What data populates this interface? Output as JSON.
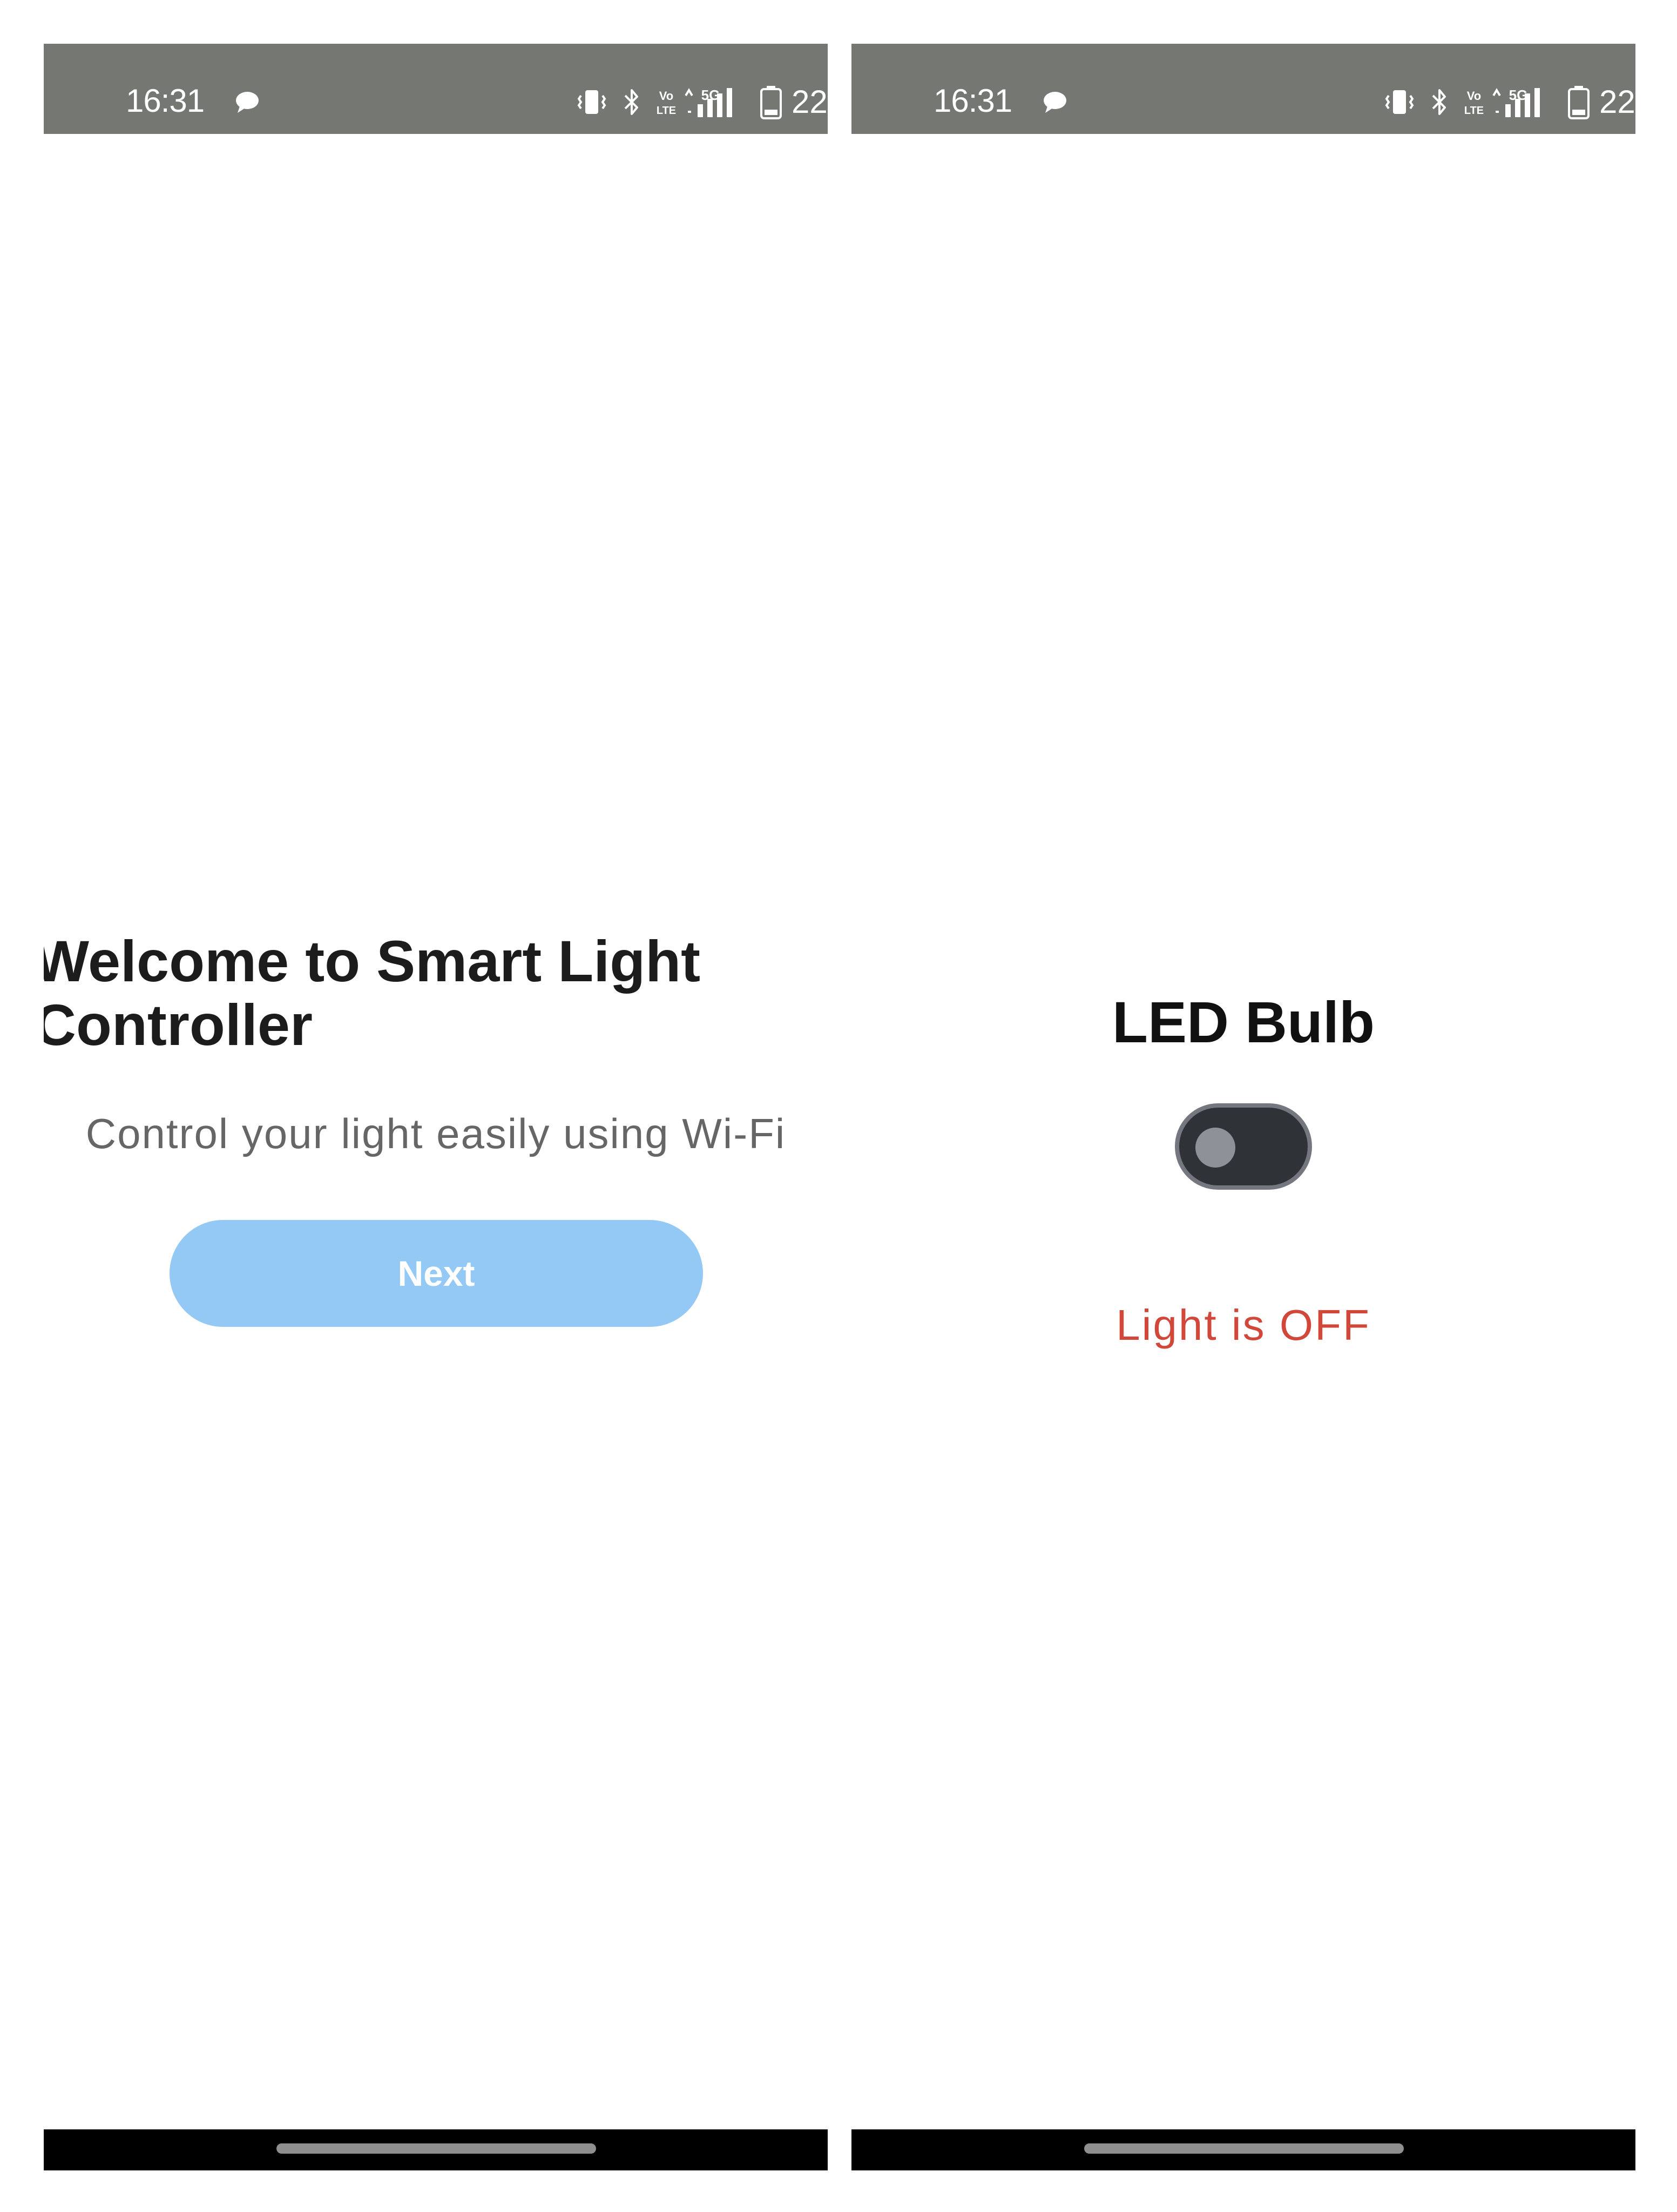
{
  "status_bar": {
    "time": "16:31",
    "battery_percent": "22%",
    "network_label": "5G",
    "icons": [
      "chat-bubble-icon",
      "vibrate-icon",
      "bluetooth-icon",
      "volte-icon",
      "signal-icon",
      "battery-icon"
    ],
    "background_color": "#757773"
  },
  "screens": {
    "welcome": {
      "title": "Welcome to Smart Light\nController",
      "subtitle": "Control your light easily using Wi-Fi",
      "next_label": "Next",
      "button_color": "#94c9f6"
    },
    "device": {
      "title": "LED Bulb",
      "switch_on": false,
      "status_text": "Light is OFF",
      "status_color": "#d1483a"
    }
  }
}
